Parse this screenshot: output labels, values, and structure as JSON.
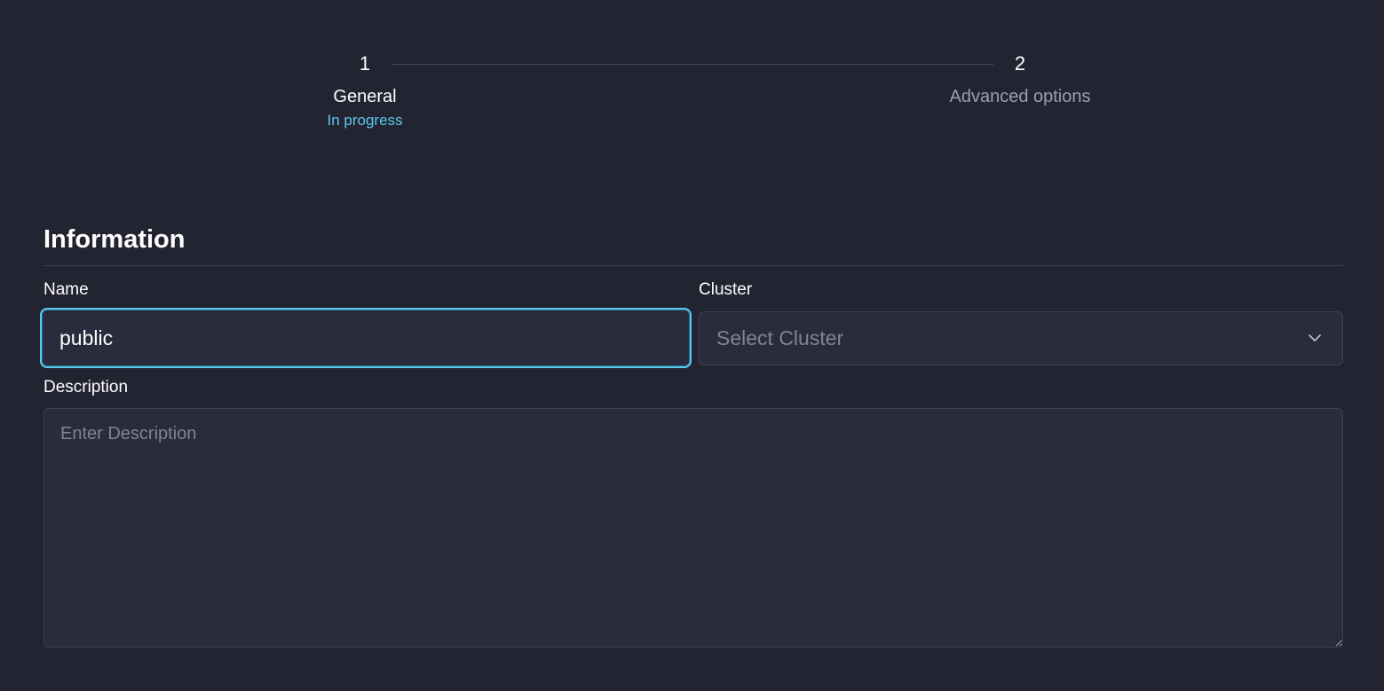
{
  "stepper": {
    "steps": [
      {
        "number": "1",
        "title": "General",
        "status": "In progress"
      },
      {
        "number": "2",
        "title": "Advanced options"
      }
    ]
  },
  "information": {
    "title": "Information",
    "name": {
      "label": "Name",
      "value": "public"
    },
    "cluster": {
      "label": "Cluster",
      "placeholder": "Select Cluster",
      "icon": "chevron-down-icon"
    },
    "description": {
      "label": "Description",
      "placeholder": "Enter Description"
    }
  },
  "colors": {
    "background": "#222431",
    "accent": "#5cc8f0",
    "field_background": "#2a2c3d",
    "muted_text": "#9aa0ad"
  }
}
